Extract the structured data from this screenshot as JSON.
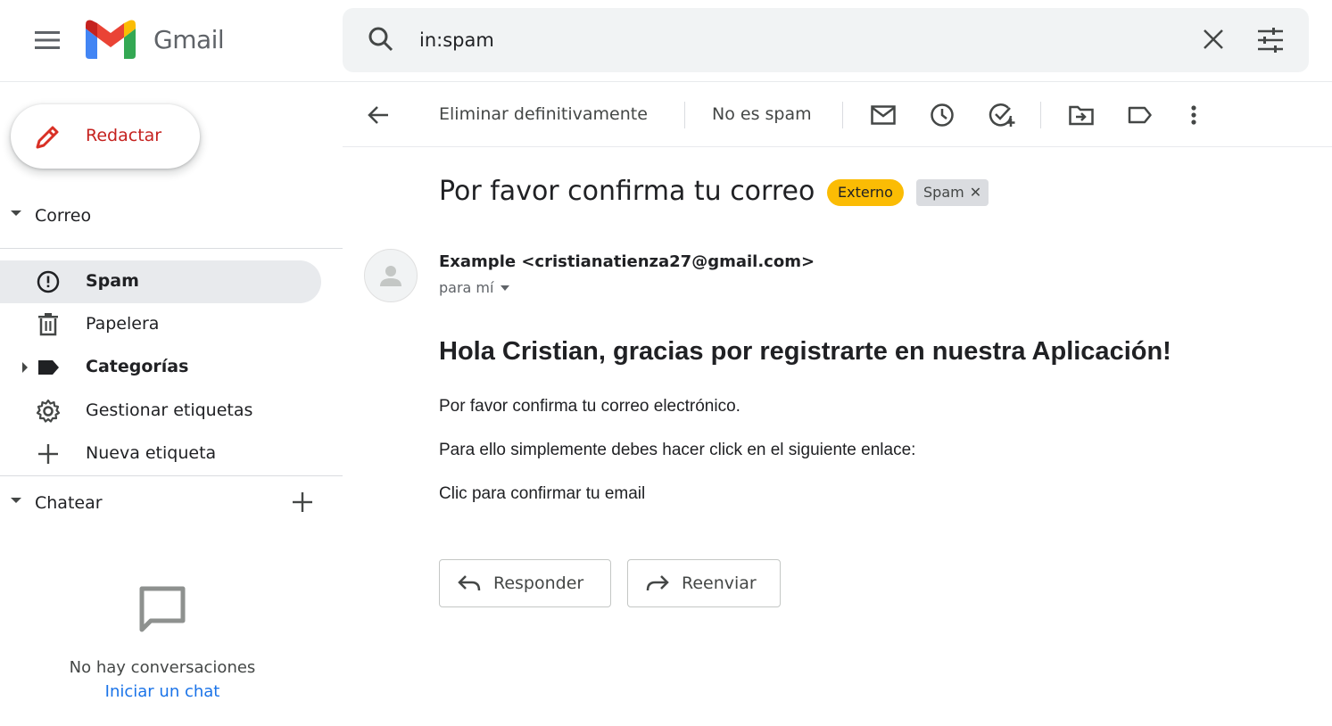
{
  "app": {
    "brand": "Gmail",
    "colors": {
      "compose_text": "#c5221f",
      "external_badge": "#fbbc04",
      "spam_badge": "#dadce0",
      "link": "#1a73e8",
      "active_nav_bg": "#e8eaed"
    }
  },
  "header": {
    "menu_icon": "hamburger-icon",
    "search": {
      "value": "in:spam",
      "search_icon": "search-icon",
      "clear_icon": "close-icon",
      "options_icon": "tune-icon"
    }
  },
  "sidebar": {
    "compose_label": "Redactar",
    "mail_section_label": "Correo",
    "items": [
      {
        "label": "Spam",
        "icon": "spam-icon",
        "active": true,
        "bold": true
      },
      {
        "label": "Papelera",
        "icon": "trash-icon",
        "active": false,
        "bold": false
      },
      {
        "label": "Categorías",
        "icon": "label-icon",
        "active": false,
        "bold": true
      },
      {
        "label": "Gestionar etiquetas",
        "icon": "gear-icon",
        "active": false,
        "bold": false
      },
      {
        "label": "Nueva etiqueta",
        "icon": "plus-icon",
        "active": false,
        "bold": false
      }
    ],
    "chat_section_label": "Chatear",
    "empty_chat_text": "No hay conversaciones",
    "start_chat_link": "Iniciar un chat"
  },
  "toolbar": {
    "back_icon": "arrow-back-icon",
    "delete_forever_label": "Eliminar definitivamente",
    "not_spam_label": "No es spam",
    "icons": [
      "mark-unread-icon",
      "snooze-icon",
      "add-task-icon",
      "move-to-icon",
      "label-icon",
      "more-vert-icon"
    ]
  },
  "message": {
    "subject": "Por favor confirma tu correo",
    "badge_external": "Externo",
    "badge_spam": "Spam",
    "sender": "Example <cristianatienza27@gmail.com>",
    "to": "para mí",
    "heading": "Hola Cristian, gracias por registrarte en nuestra Aplicación!",
    "paragraphs": [
      "Por favor confirma tu correo electrónico.",
      "Para ello simplemente debes hacer click en el siguiente enlace:",
      "Clic para confirmar tu email"
    ],
    "reply_label": "Responder",
    "forward_label": "Reenviar"
  }
}
